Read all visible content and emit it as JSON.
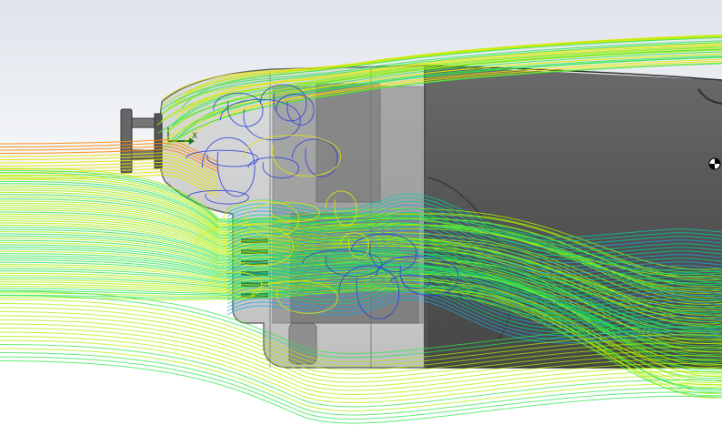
{
  "viewport": {
    "name": "flow-simulation-3d-view",
    "background_top": "#dfe3ea",
    "background_bottom": "#ffffff"
  },
  "model": {
    "body_color": "#555555",
    "body_dark": "#3c3c3c",
    "engine_color": "#8a8a8a",
    "engine_dark": "#4a4a4a"
  },
  "streamlines": {
    "palette": [
      "#ff8a00",
      "#e8e800",
      "#a8f000",
      "#2ee64a",
      "#00d0a8",
      "#18a8e8",
      "#2a3cd8"
    ]
  },
  "triad": {
    "x_label": "X",
    "x_color": "#1a7a1a"
  },
  "center_of_mass_icon": "center-of-mass-icon"
}
